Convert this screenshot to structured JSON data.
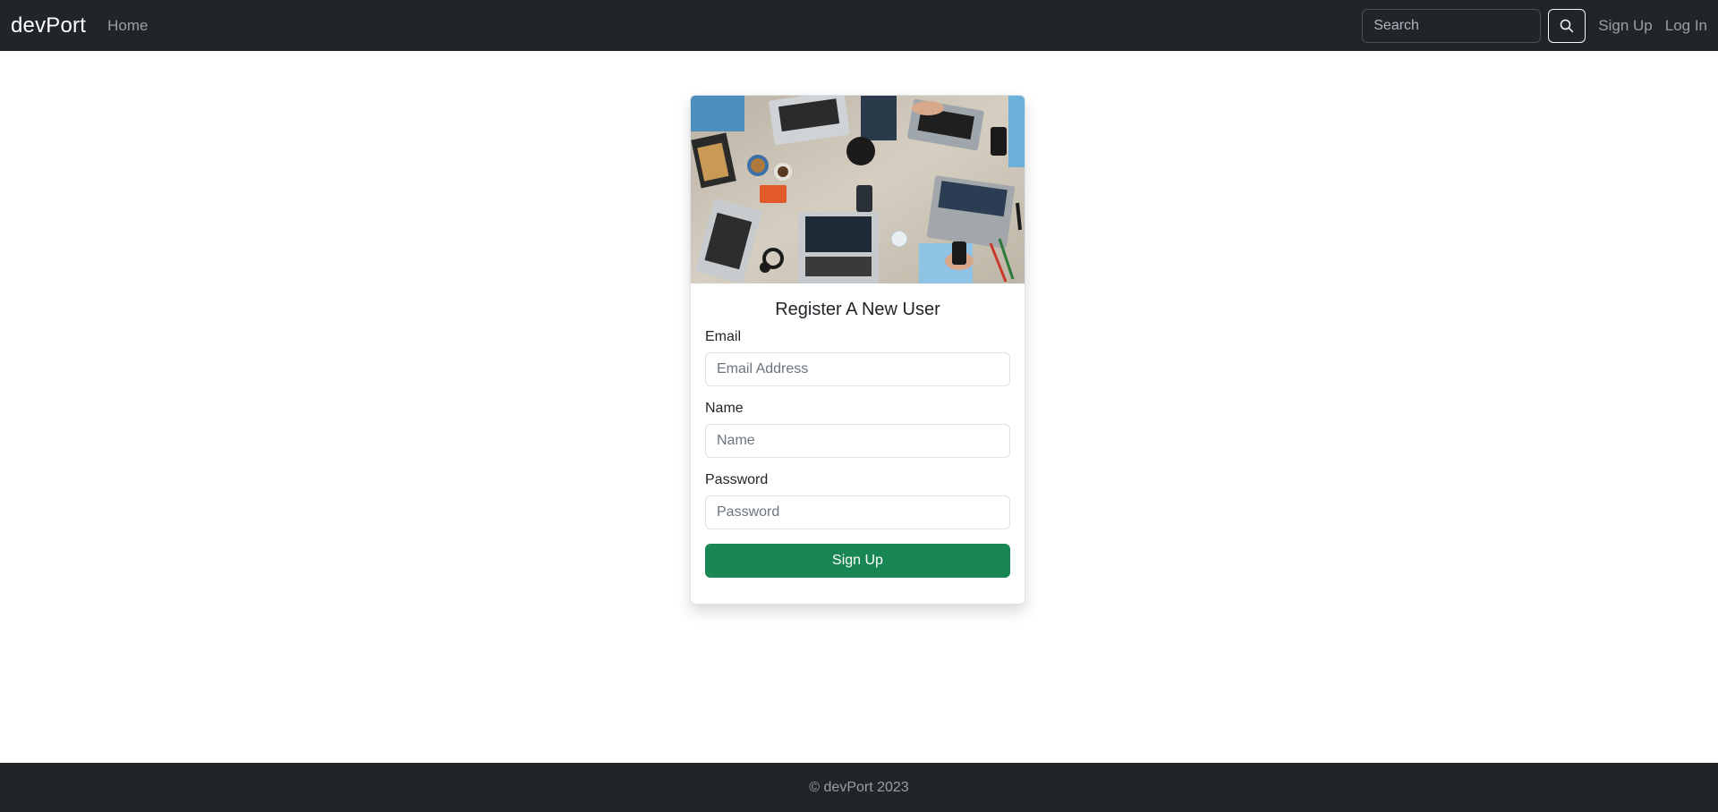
{
  "navbar": {
    "brand": "devPort",
    "links": [
      {
        "label": "Home"
      }
    ],
    "search": {
      "placeholder": "Search",
      "value": ""
    },
    "search_icon": "search-icon",
    "right_links": [
      {
        "label": "Sign Up"
      },
      {
        "label": "Log In"
      }
    ]
  },
  "card": {
    "image": "workspace-laptops-photo",
    "title": "Register A New User",
    "fields": [
      {
        "label": "Email",
        "placeholder": "Email Address",
        "value": ""
      },
      {
        "label": "Name",
        "placeholder": "Name",
        "value": ""
      },
      {
        "label": "Password",
        "placeholder": "Password",
        "value": ""
      }
    ],
    "submit_label": "Sign Up"
  },
  "footer": {
    "text": "© devPort 2023"
  },
  "colors": {
    "navbar_bg": "#212529",
    "submit_bg": "#198754",
    "footer_bg": "#212529"
  }
}
